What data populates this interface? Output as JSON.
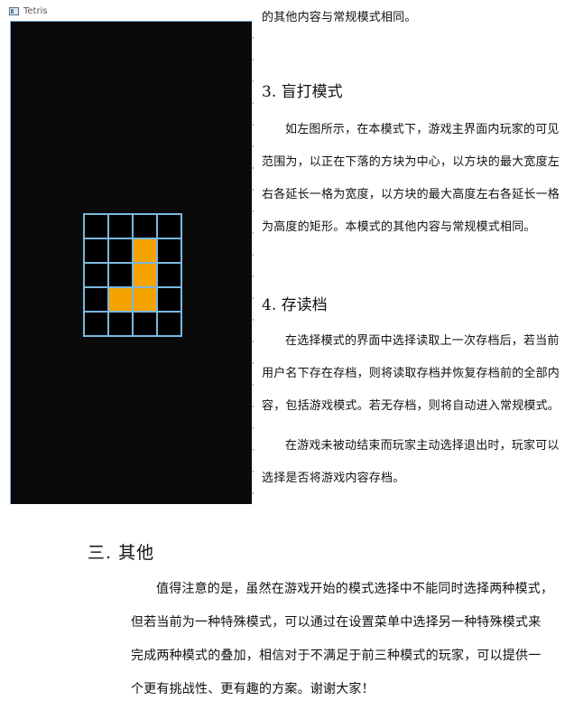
{
  "window": {
    "title": "Tetris",
    "grid": {
      "columns": 4,
      "rows": 5,
      "filled_cells": [
        [
          1,
          2
        ],
        [
          2,
          2
        ],
        [
          3,
          1
        ],
        [
          3,
          2
        ]
      ],
      "piece_color": "#f5a300",
      "grid_color": "#7ab8e0",
      "background": "#0a0a0a"
    }
  },
  "text": {
    "top_line": "的其他内容与常规模式相同。",
    "section3_heading": "3. 盲打模式",
    "section3_lines": [
      "如左图所示，在本模式下，游戏主界面内玩家的可见",
      "范围为，以正在下落的方块为中心，以方块的最大宽度左",
      "右各延长一格为宽度，以方块的最大高度左右各延长一格",
      "为高度的矩形。本模式的其他内容与常规模式相同。"
    ],
    "section4_heading": "4. 存读档",
    "section4_p1_lines": [
      "在选择模式的界面中选择读取上一次存档后，若当前",
      "用户名下存在存档，则将读取存档并恢复存档前的全部内",
      "容，包括游戏模式。若无存档，则将自动进入常规模式。"
    ],
    "section4_p2_lines": [
      "在游戏未被动结束而玩家主动选择退出时，玩家可以",
      "选择是否将游戏内容存档。"
    ],
    "other_heading": "三.  其他",
    "other_lines": [
      "值得注意的是，虽然在游戏开始的模式选择中不能同时选择两种模式，",
      "但若当前为一种特殊模式，可以通过在设置菜单中选择另一种特殊模式来",
      "完成两种模式的叠加，相信对于不满足于前三种模式的玩家，可以提供一",
      "个更有挑战性、更有趣的方案。谢谢大家！"
    ]
  }
}
